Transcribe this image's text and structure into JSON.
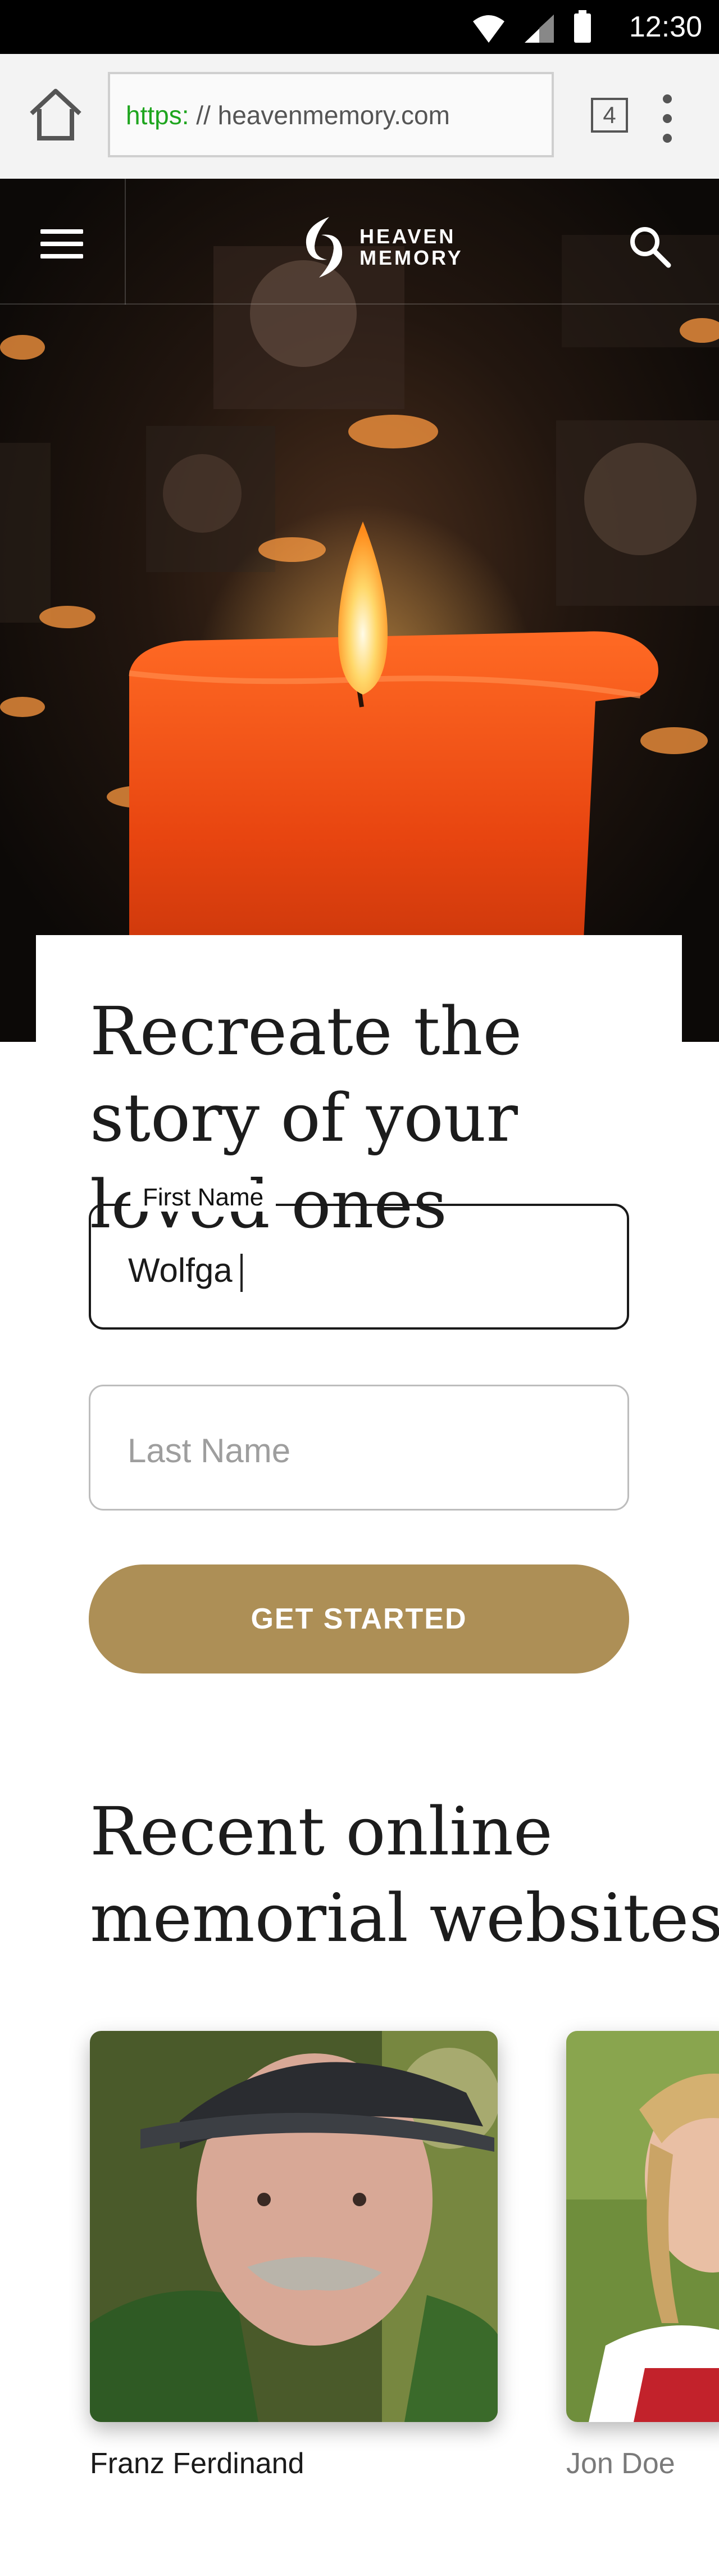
{
  "status_bar": {
    "time": "12:30",
    "icons": [
      "wifi-icon",
      "signal-icon",
      "battery-icon"
    ]
  },
  "browser": {
    "url_scheme": "https:",
    "url_rest": " // heavenmemory.com",
    "tab_count": "4",
    "icons": [
      "home-icon",
      "tabs-icon",
      "overflow-menu-icon"
    ]
  },
  "site_header": {
    "logo_line1": "HEAVEN",
    "logo_line2": "MEMORY",
    "icons": [
      "menu-icon",
      "logo-icon",
      "search-icon"
    ]
  },
  "hero_form": {
    "headline": "Recreate the story of your loved ones",
    "first_name_label": "First Name",
    "first_name_value": "Wolfga",
    "last_name_placeholder": "Last Name",
    "cta_label": "GET STARTED"
  },
  "recent": {
    "title": "Recent online memorial websites",
    "memorials": [
      {
        "name": "Franz Ferdinand"
      },
      {
        "name": "Jon Doe"
      }
    ]
  },
  "colors": {
    "accent": "#ad8f56",
    "url_scheme": "#1ea51e",
    "text_dark": "#1c1c1c",
    "status_bar": "#000000"
  }
}
